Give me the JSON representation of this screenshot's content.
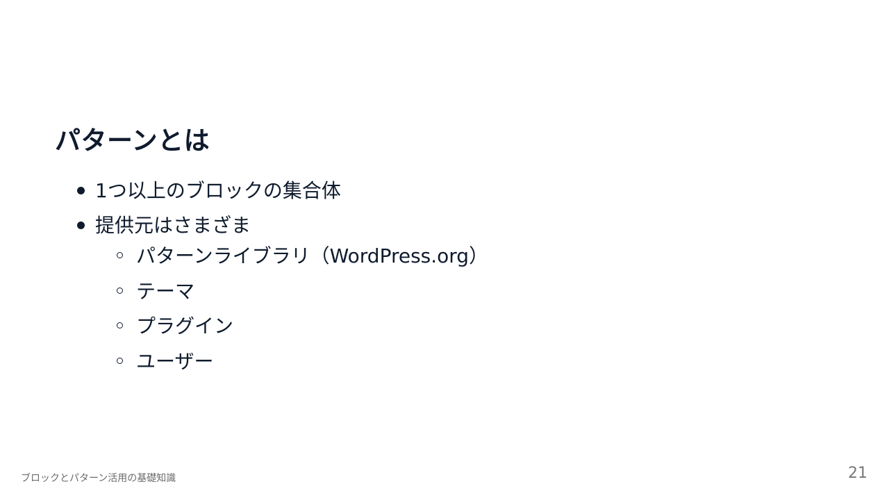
{
  "slide": {
    "title": "パターンとは",
    "bullets": [
      {
        "text": "1つ以上のブロックの集合体"
      },
      {
        "text": "提供元はさまざま"
      }
    ],
    "sub_bullets": [
      {
        "text": "パターンライブラリ（WordPress.org）"
      },
      {
        "text": "テーマ"
      },
      {
        "text": "プラグイン"
      },
      {
        "text": "ユーザー"
      }
    ]
  },
  "footer": {
    "text": "ブロックとパターン活用の基礎知識",
    "page_number": "21"
  }
}
